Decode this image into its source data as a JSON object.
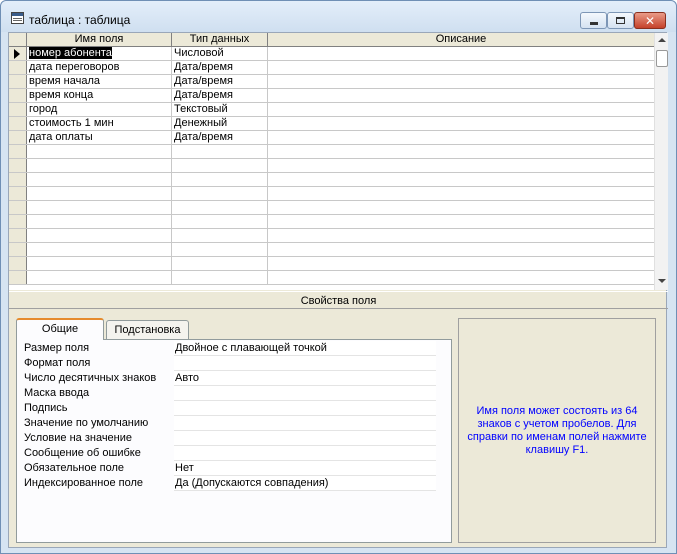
{
  "window": {
    "title": "таблица : таблица",
    "accent_color": "#d6e4f2",
    "close_color": "#c5412a",
    "close_glyph": "✕"
  },
  "grid": {
    "headers": {
      "name": "Имя поля",
      "type": "Тип данных",
      "description": "Описание"
    },
    "rows": [
      {
        "name": "номер абонента",
        "type": "Числовой",
        "description": ""
      },
      {
        "name": "дата переговоров",
        "type": "Дата/время",
        "description": ""
      },
      {
        "name": "время начала",
        "type": "Дата/время",
        "description": ""
      },
      {
        "name": "время конца",
        "type": "Дата/время",
        "description": ""
      },
      {
        "name": "город",
        "type": "Текстовый",
        "description": ""
      },
      {
        "name": "стоимость 1 мин",
        "type": "Денежный",
        "description": ""
      },
      {
        "name": "дата оплаты",
        "type": "Дата/время",
        "description": ""
      }
    ],
    "selected_row": 0
  },
  "properties": {
    "title": "Свойства поля",
    "tabs": {
      "general": "Общие",
      "lookup": "Подстановка"
    },
    "rows": [
      {
        "label": "Размер поля",
        "value": "Двойное с плавающей точкой"
      },
      {
        "label": "Формат поля",
        "value": ""
      },
      {
        "label": "Число десятичных знаков",
        "value": "Авто"
      },
      {
        "label": "Маска ввода",
        "value": ""
      },
      {
        "label": "Подпись",
        "value": ""
      },
      {
        "label": "Значение по умолчанию",
        "value": ""
      },
      {
        "label": "Условие на значение",
        "value": ""
      },
      {
        "label": "Сообщение об ошибке",
        "value": ""
      },
      {
        "label": "Обязательное поле",
        "value": "Нет"
      },
      {
        "label": "Индексированное поле",
        "value": "Да (Допускаются совпадения)"
      }
    ],
    "help_text": "Имя поля может состоять из 64 знаков с учетом пробелов.  Для справки по именам полей нажмите клавишу F1."
  }
}
